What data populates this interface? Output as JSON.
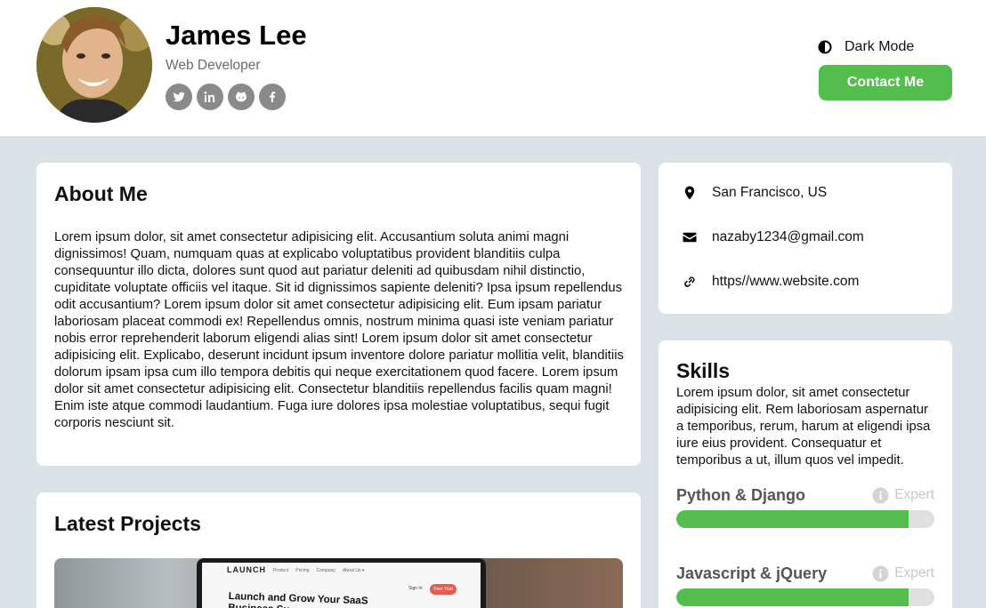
{
  "profile": {
    "name": "James Lee",
    "role": "Web Developer",
    "socials": [
      {
        "icon": "twitter-icon"
      },
      {
        "icon": "linkedin-icon"
      },
      {
        "icon": "github-icon"
      },
      {
        "icon": "facebook-icon"
      }
    ]
  },
  "header": {
    "dark_mode_label": "Dark Mode",
    "contact_label": "Contact Me",
    "accent_color": "#53bd4d"
  },
  "about": {
    "title": "About Me",
    "text": "Lorem ipsum dolor, sit amet consectetur adipisicing elit. Accusantium soluta animi magni dignissimos! Quam, numquam quas at explicabo voluptatibus provident blanditiis culpa consequuntur illo dicta, dolores sunt quod aut pariatur deleniti ad quibusdam nihil distinctio, cupiditate voluptate officiis vel itaque. Sit id dignissimos sapiente deleniti? Ipsa ipsum repellendus odit accusantium? Lorem ipsum dolor sit amet consectetur adipisicing elit. Eum ipsam pariatur laboriosam placeat commodi ex! Repellendus omnis, nostrum minima quasi iste veniam pariatur nobis error reprehenderit laborum eligendi alias sint! Lorem ipsum dolor sit amet consectetur adipisicing elit. Explicabo, deserunt incidunt ipsum inventore dolore pariatur mollitia velit, blanditiis dolorum ipsam ipsa cum illo tempora debitis qui neque exercitationem quod facere. Lorem ipsum dolor sit amet consectetur adipisicing elit. Consectetur blanditiis repellendus facilis quam magni! Enim iste atque commodi laudantium. Fuga iure dolores ipsa molestiae voluptatibus, sequi fugit corporis nesciunt sit."
  },
  "projects": {
    "title": "Latest Projects",
    "preview": {
      "logo": "LAUNCH",
      "nav": [
        "Product",
        "Pricing",
        "Company",
        "About Us ▾"
      ],
      "signin": "Sign In",
      "cta": "Free Trial",
      "headline": "Launch and Grow Your SaaS Business Su"
    }
  },
  "contact": {
    "location": "San Francisco, US",
    "email": "nazaby1234@gmail.com",
    "website": "https//www.website.com"
  },
  "skills": {
    "title": "Skills",
    "text": "Lorem ipsum dolor, sit amet consectetur adipisicing elit. Rem laboriosam aspernatur a temporibus, rerum, harum at eligendi ipsa iure eius provident. Consequatur et temporibus a ut, illum quos vel impedit.",
    "items": [
      {
        "name": "Python & Django",
        "level": "Expert",
        "progress": 0.9
      },
      {
        "name": "Javascript & jQuery",
        "level": "Expert",
        "progress": 0.9
      }
    ]
  }
}
